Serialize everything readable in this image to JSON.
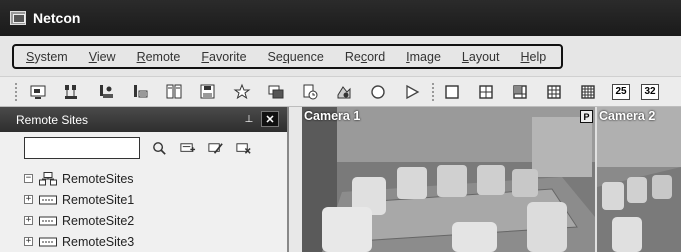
{
  "window": {
    "title": "Netcon"
  },
  "menu": [
    {
      "pre": "",
      "ul": "S",
      "post": "ystem"
    },
    {
      "pre": "",
      "ul": "V",
      "post": "iew"
    },
    {
      "pre": "",
      "ul": "R",
      "post": "emote"
    },
    {
      "pre": "",
      "ul": "F",
      "post": "avorite"
    },
    {
      "pre": "Se",
      "ul": "q",
      "post": "uence"
    },
    {
      "pre": "Re",
      "ul": "c",
      "post": "ord"
    },
    {
      "pre": "",
      "ul": "I",
      "post": "mage"
    },
    {
      "pre": "",
      "ul": "L",
      "post": "ayout"
    },
    {
      "pre": "",
      "ul": "H",
      "post": "elp"
    }
  ],
  "toolbar": {
    "layout_25_label": "25",
    "layout_32_label": "32"
  },
  "panel": {
    "title": "Remote Sites",
    "pin_glyph": "⊥",
    "close_glyph": "✕",
    "search": {
      "value": "",
      "placeholder": ""
    }
  },
  "tree": {
    "root": {
      "label": "RemoteSites",
      "expander": "−"
    },
    "children": [
      {
        "label": "RemoteSite1",
        "expander": "+"
      },
      {
        "label": "RemoteSite2",
        "expander": "+"
      },
      {
        "label": "RemoteSite3",
        "expander": "+"
      }
    ]
  },
  "cameras": [
    {
      "label": "Camera 1",
      "flag": "P"
    },
    {
      "label": "Camera 2",
      "flag": ""
    }
  ]
}
